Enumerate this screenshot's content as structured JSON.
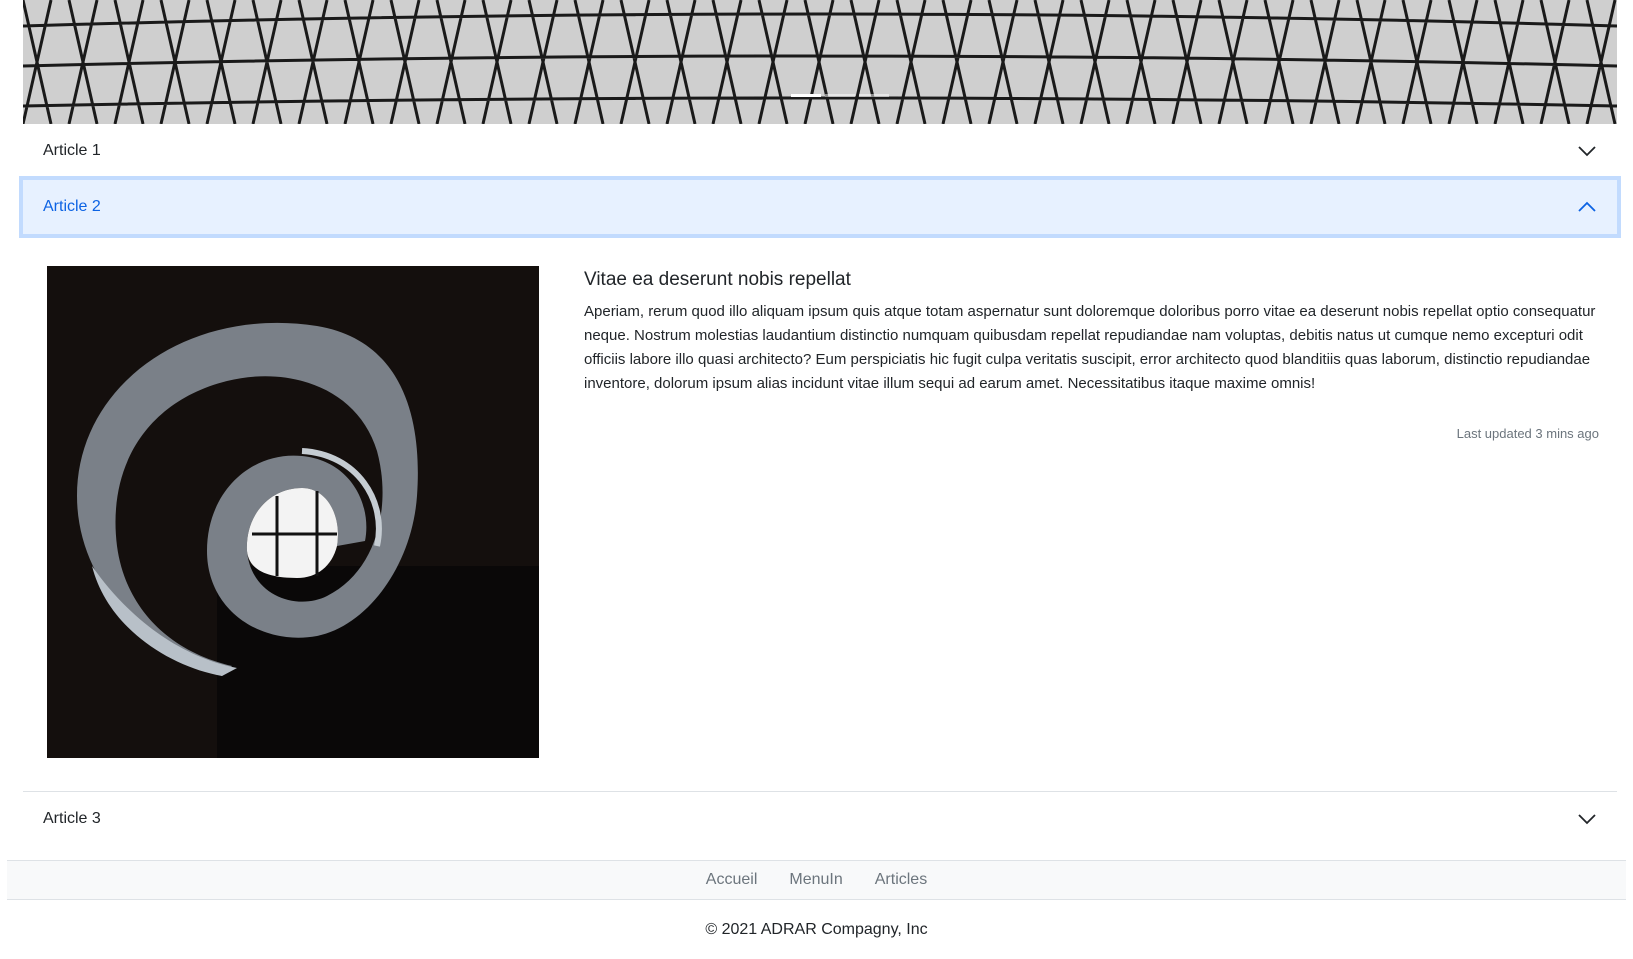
{
  "carousel": {
    "indicator_count": 3,
    "active_index": 0
  },
  "accordion": {
    "items": [
      {
        "title": "Article 1",
        "expanded": false
      },
      {
        "title": "Article 2",
        "expanded": true
      },
      {
        "title": "Article 3",
        "expanded": false
      }
    ],
    "active_color": "#0c63e4",
    "active_bg": "#e7f1ff"
  },
  "article": {
    "heading": "Vitae ea deserunt nobis repellat",
    "body": "Aperiam, rerum quod illo aliquam ipsum quis atque totam aspernatur sunt doloremque doloribus porro vitae ea deserunt nobis repellat optio consequatur neque. Nostrum molestias laudantium distinctio numquam quibusdam repellat repudiandae nam voluptas, debitis natus ut cumque nemo excepturi odit officiis labore illo quasi architecto? Eum perspiciatis hic fugit culpa veritatis suscipit, error architecto quod blanditiis quas laborum, distinctio repudiandae inventore, dolorum ipsum alias incidunt vitae illum sequi ad earum amet. Necessitatibus itaque maxime omnis!",
    "updated": "Last updated 3 mins ago"
  },
  "footer": {
    "nav": [
      "Accueil",
      "MenuIn",
      "Articles"
    ],
    "copyright": "© 2021 ADRAR Compagny, Inc"
  }
}
